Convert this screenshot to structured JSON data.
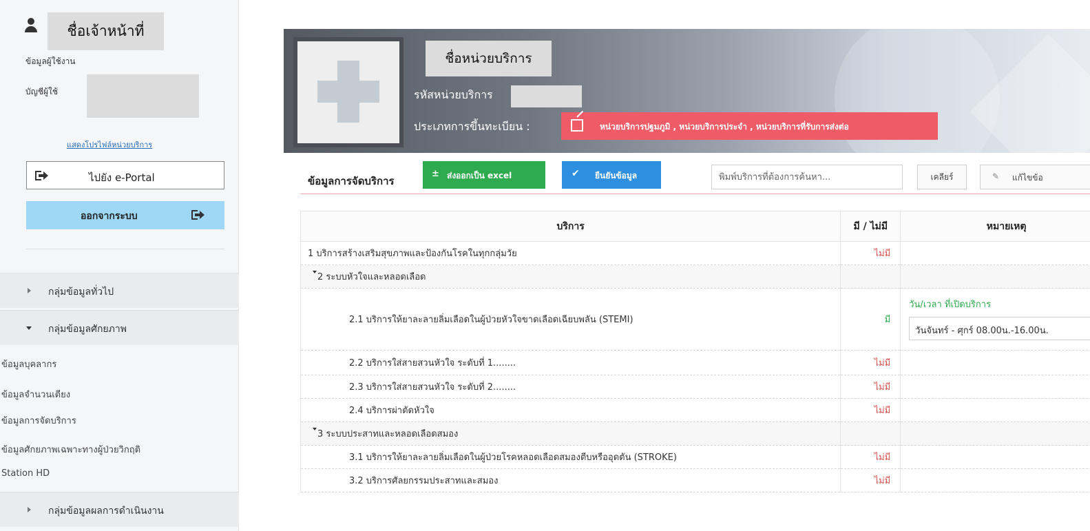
{
  "sidebar": {
    "officer_name": "ชื่อเจ้าหน้าที่",
    "user_info_label": "ข้อมูลผู้ใช้งาน",
    "account_label": "บัญชีผู้ใช้",
    "profile_link": "แสดงโปรไฟล์หน่วยบริการ",
    "portal_button": "ไปยัง e-Portal",
    "logout_button": "ออกจากระบบ",
    "groups": {
      "general": "กลุ่มข้อมูลทั่วไป",
      "capability": "กลุ่มข้อมูลศักยภาพ",
      "performance": "กลุ่มข้อมูลผลการดำเนินงาน"
    },
    "sub_items": [
      "ข้อมูลบุคลากร",
      "ข้อมูลจำนวนเตียง",
      "ข้อมูลการจัดบริการ",
      "ข้อมูลศักยภาพเฉพาะทางผู้ป่วยวิกฤติ",
      "Station HD"
    ]
  },
  "unit": {
    "name": "ชื่อหน่วยบริการ",
    "code_label": "รหัสหน่วยบริการ",
    "registration_label": "ประเภทการขึ้นทะเบียน :",
    "registration_types": "หน่วยบริการปฐมภูมิ , หน่วยบริการประจำ , หน่วยบริการที่รับการส่งต่อ"
  },
  "toolbar": {
    "title": "ข้อมูลการจัดบริการ",
    "export_button": "ส่งออกเป็น excel",
    "confirm_button": "ยืนยันข้อมูล",
    "search_placeholder": "พิมพ์บริการที่ต้องการค้นหา...",
    "clear_button": "เคลียร์",
    "edit_button": "แก้ไขข้อ"
  },
  "table": {
    "headers": {
      "service": "บริการ",
      "status": "มี / ไม่มี",
      "note": "หมายเหตุ"
    },
    "rows": [
      {
        "label": "1 บริการสร้างเสริมสุขภาพและป้องกันโรคในทุกกลุ่มวัย",
        "status": "ไม่มี"
      },
      {
        "label": "2 ระบบหัวใจและหลอดเลือด",
        "status": ""
      },
      {
        "label": "2.1 บริการให้ยาละลายลิ่มเลือดในผู้ป่วยหัวใจขาดเลือดเฉียบพลัน (STEMI)",
        "status": "มี",
        "note_label": "วัน/เวลา ที่เปิดบริการ",
        "note_value": "วันจันทร์ - ศุกร์ 08.00น.-16.00น."
      },
      {
        "label": "2.2 บริการใส่สายสวนหัวใจ ระดับที่ 1........",
        "status": "ไม่มี"
      },
      {
        "label": "2.3 บริการใส่สายสวนหัวใจ ระดับที่ 2........",
        "status": "ไม่มี"
      },
      {
        "label": "2.4 บริการผ่าตัดหัวใจ",
        "status": "ไม่มี"
      },
      {
        "label": "3 ระบบประสาทและหลอดเลือดสมอง",
        "status": ""
      },
      {
        "label": "3.1 บริการให้ยาละลายลิ่มเลือดในผู้ป่วยโรคหลอดเลือดสมองตีบหรืออุดตัน (STROKE)",
        "status": "ไม่มี"
      },
      {
        "label": "3.2 บริการศัลยกรรมประสาทและสมอง",
        "status": "ไม่มี"
      }
    ]
  },
  "colors": {
    "excel_green": "#2eaa4f",
    "confirm_blue": "#2e8fe0",
    "badge_red": "#ef5b66",
    "logout_blue": "#9fd8f7",
    "status_no": "#d9534f",
    "status_yes": "#2eaa4f"
  }
}
